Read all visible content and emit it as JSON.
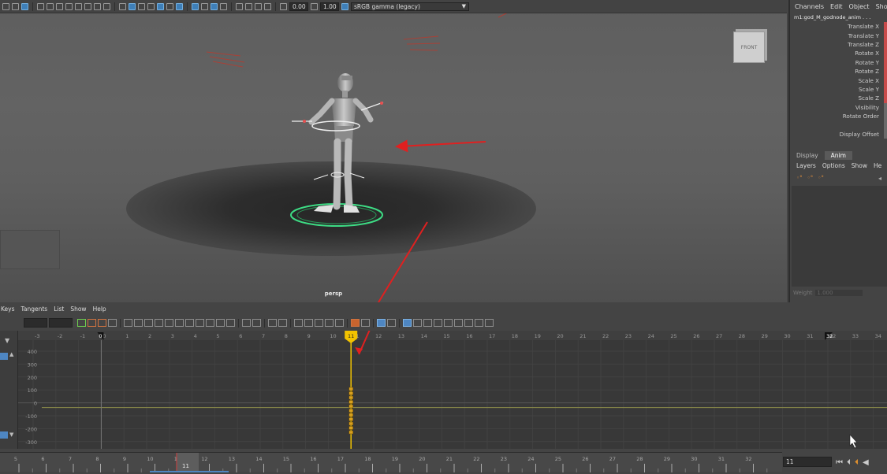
{
  "toolbar": {
    "exposure_value": "0.00",
    "gamma_value": "1.00",
    "color_space": "sRGB gamma (legacy)"
  },
  "viewport": {
    "camera_label": "persp",
    "view_cube_label": "FRONT"
  },
  "channel_box": {
    "menu": [
      "Channels",
      "Edit",
      "Object",
      "Sho"
    ],
    "node_name": "m1:god_M_godnode_anim . . .",
    "attributes": [
      "Translate X",
      "Translate Y",
      "Translate Z",
      "Rotate X",
      "Rotate Y",
      "Rotate Z",
      "Scale X",
      "Scale Y",
      "Scale Z",
      "Visibility",
      "Rotate Order",
      "",
      "Display Offset"
    ],
    "tabs": [
      "Display",
      "Anim"
    ],
    "active_tab": "Anim",
    "layer_menu": [
      "Layers",
      "Options",
      "Show",
      "He"
    ],
    "weight_label": "Weight",
    "weight_value": "1.000"
  },
  "graph_editor": {
    "menu": [
      "Keys",
      "Tangents",
      "List",
      "Show",
      "Help"
    ],
    "frame_ticks": [
      "-3",
      "-2",
      "-1",
      "0",
      "1",
      "2",
      "3",
      "4",
      "5",
      "6",
      "7",
      "8",
      "9",
      "10",
      "11",
      "12",
      "13",
      "14",
      "15",
      "16",
      "17",
      "18",
      "19",
      "20",
      "21",
      "22",
      "23",
      "24",
      "25",
      "26",
      "27",
      "28",
      "29",
      "30",
      "31",
      "32",
      "33",
      "34"
    ],
    "value_ticks": [
      "400",
      "300",
      "200",
      "100",
      "0",
      "-100",
      "-200",
      "-300"
    ],
    "current_frame": "11",
    "start_marker": "0",
    "end_marker": "32"
  },
  "time_slider": {
    "ticks": [
      "5",
      "6",
      "7",
      "8",
      "9",
      "10",
      "11",
      "12",
      "13",
      "14",
      "15",
      "16",
      "17",
      "18",
      "19",
      "20",
      "21",
      "22",
      "23",
      "24",
      "25",
      "26",
      "27",
      "28",
      "29",
      "30",
      "31",
      "32"
    ],
    "current_frame": "11",
    "current_time_field": "11"
  },
  "colors": {
    "accent_yellow": "#f2c300",
    "arrow_red": "#e02020",
    "ground_ring": "#3ddc84"
  }
}
